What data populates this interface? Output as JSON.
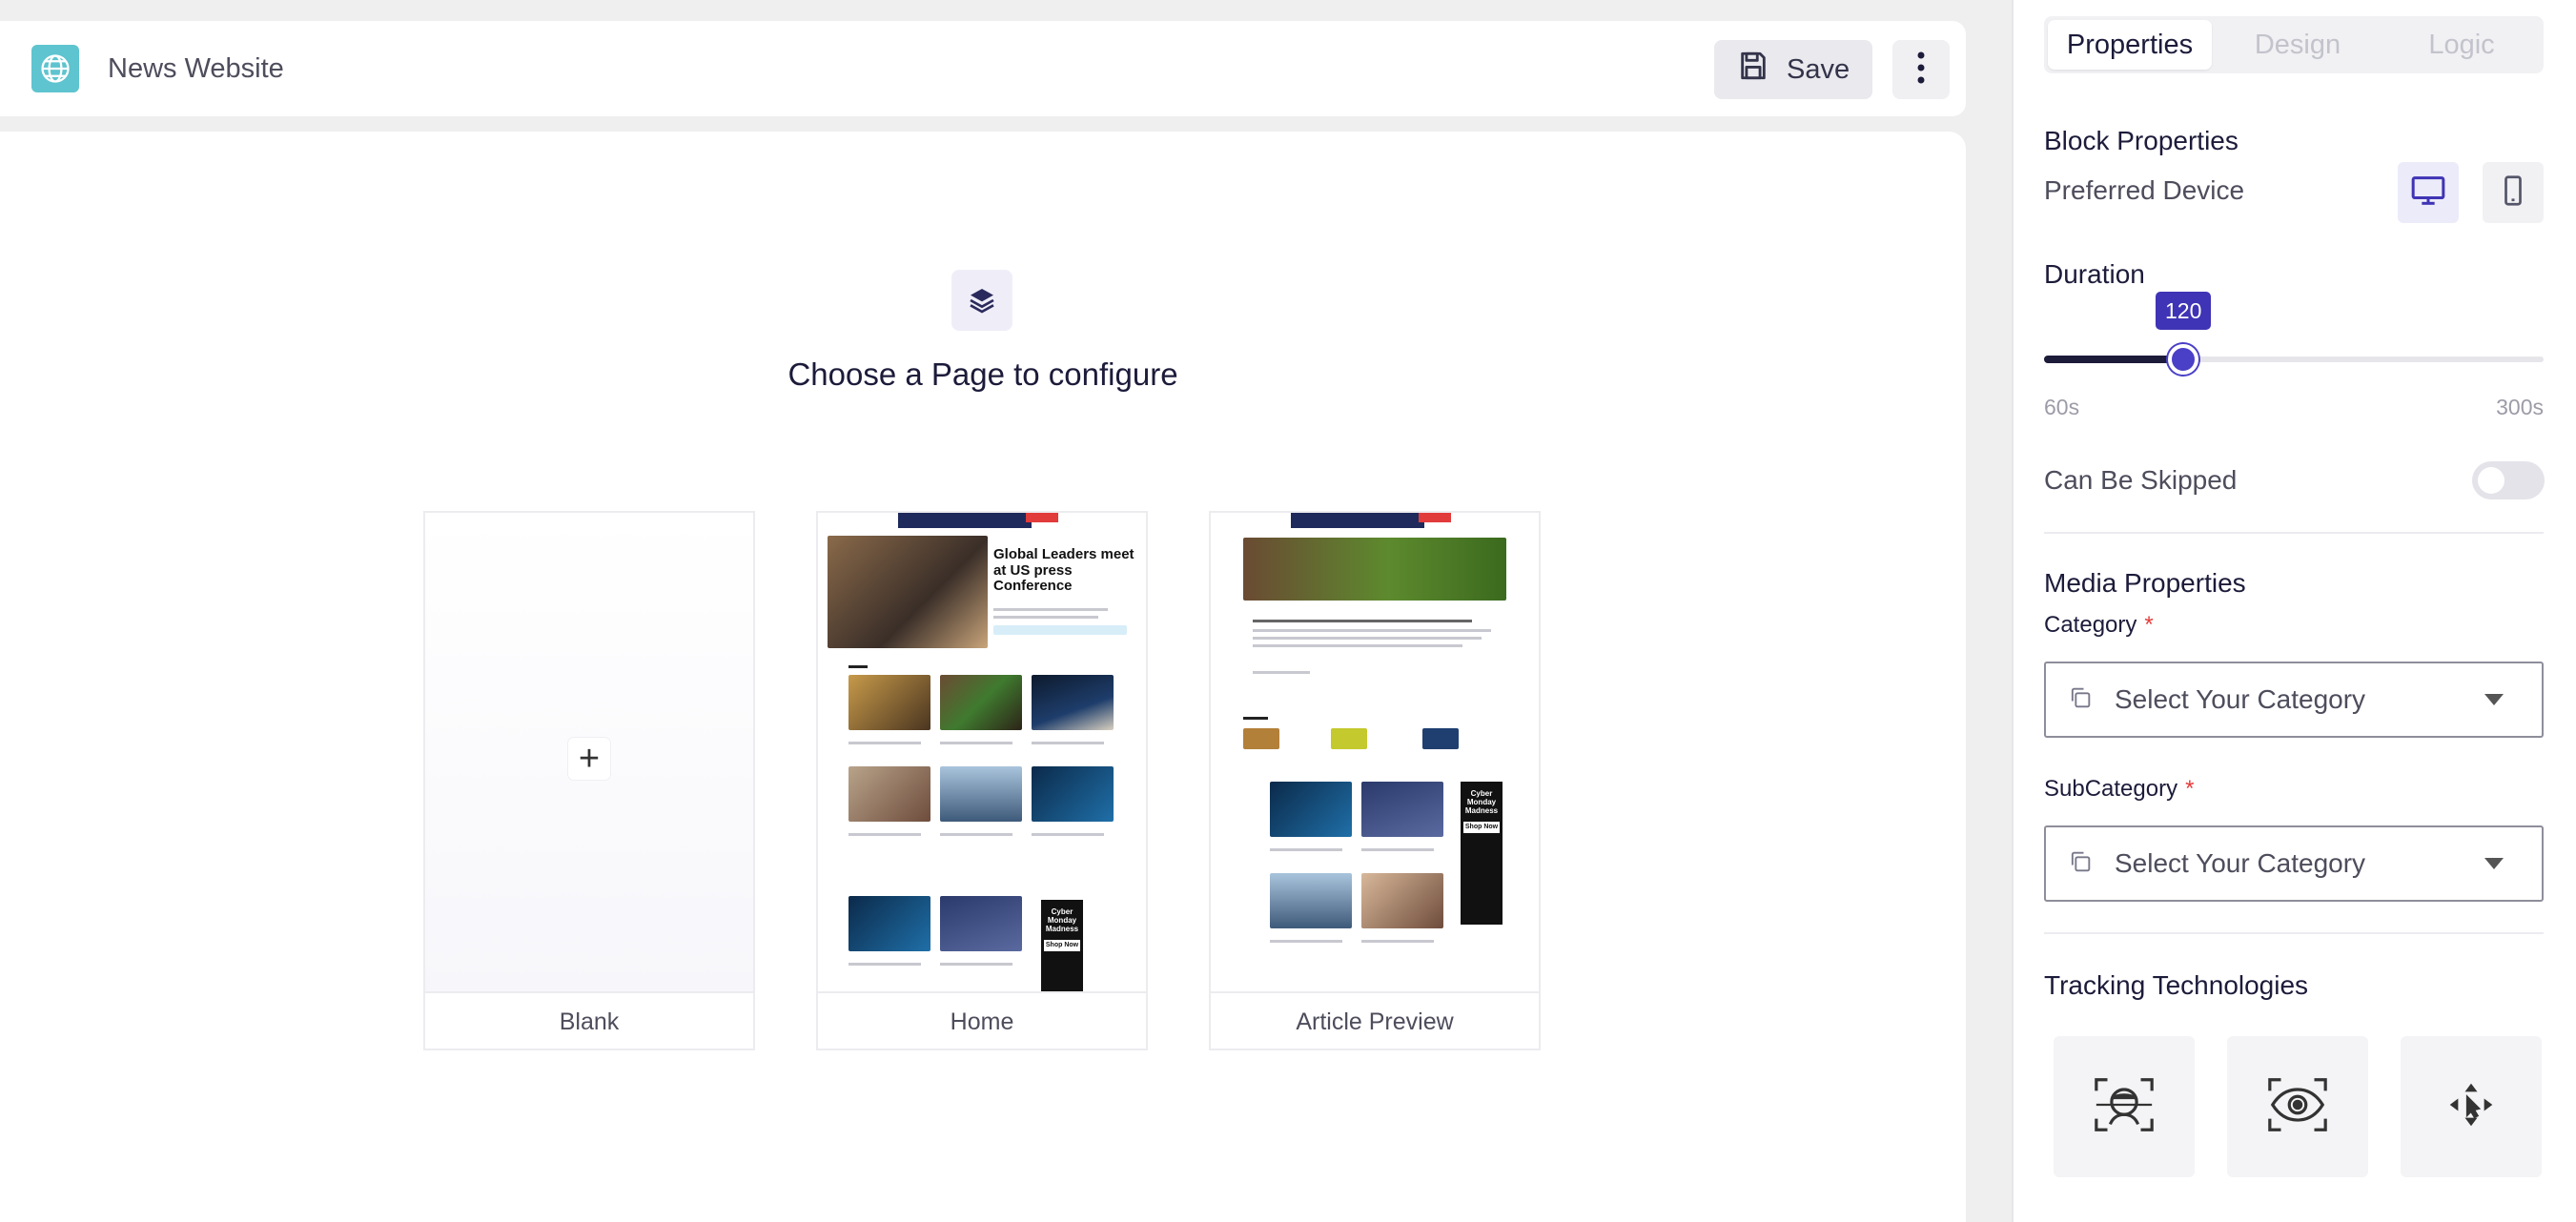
{
  "header": {
    "site_title": "News Website",
    "save_label": "Save",
    "site_icon": "globe-icon",
    "save_icon": "floppy-disk-icon",
    "more_icon": "vertical-dots-icon"
  },
  "canvas": {
    "title": "Choose a Page to configure",
    "icon": "layers-icon",
    "pages": [
      {
        "label": "Blank"
      },
      {
        "label": "Home",
        "headline": "Global Leaders meet at US press Conference",
        "ad_text": "Cyber Monday Madness",
        "ad_button": "Shop Now"
      },
      {
        "label": "Article Preview",
        "ad_text": "Cyber Monday Madness",
        "ad_button": "Shop Now"
      }
    ]
  },
  "panel": {
    "tabs": [
      {
        "label": "Properties",
        "active": true
      },
      {
        "label": "Design",
        "active": false
      },
      {
        "label": "Logic",
        "active": false
      }
    ],
    "block_properties": {
      "title": "Block Properties",
      "preferred_device_label": "Preferred Device",
      "devices": [
        "desktop-icon",
        "mobile-icon"
      ],
      "selected_device": "desktop"
    },
    "duration": {
      "title": "Duration",
      "value": "120",
      "min_label": "60s",
      "max_label": "300s",
      "min": 60,
      "max": 300,
      "current": 120
    },
    "skip": {
      "label": "Can Be Skipped",
      "enabled": false
    },
    "media_properties": {
      "title": "Media Properties",
      "category_label": "Category",
      "category_placeholder": "Select Your Category",
      "subcategory_label": "SubCategory",
      "subcategory_placeholder": "Select Your Category",
      "required_mark": "*"
    },
    "tracking": {
      "title": "Tracking Technologies",
      "items": [
        "face-scan-icon",
        "eye-scan-icon",
        "pointer-scan-icon"
      ]
    }
  },
  "colors": {
    "accent": "#4a3fc7",
    "site_icon_bg": "#5ec4cf",
    "required": "#e53b3b"
  }
}
